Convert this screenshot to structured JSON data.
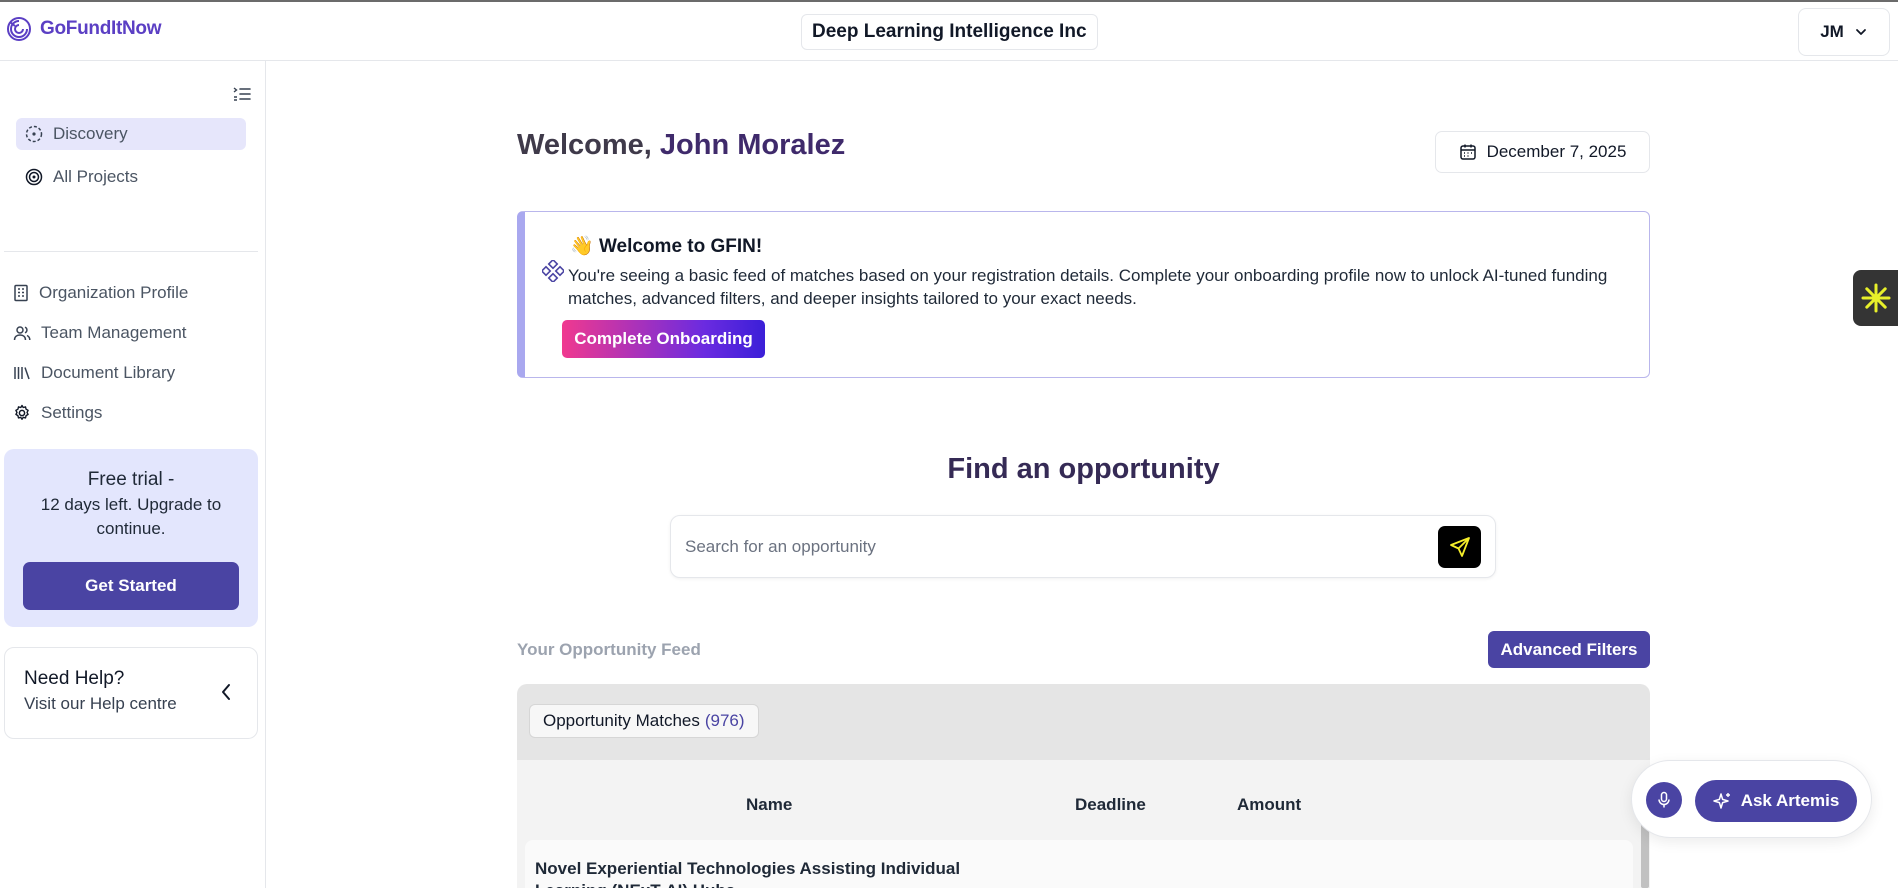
{
  "header": {
    "logo_text": "GoFundItNow",
    "organization": "Deep Learning Intelligence Inc",
    "user_initials": "JM"
  },
  "sidebar": {
    "primary": [
      {
        "label": "Discovery",
        "icon": "discovery-icon",
        "active": true
      },
      {
        "label": "All Projects",
        "icon": "target-icon",
        "active": false
      }
    ],
    "secondary": [
      {
        "label": "Organization Profile",
        "icon": "building-icon"
      },
      {
        "label": "Team Management",
        "icon": "users-icon"
      },
      {
        "label": "Document Library",
        "icon": "library-icon"
      },
      {
        "label": "Settings",
        "icon": "gear-icon"
      }
    ],
    "trial": {
      "title": "Free trial -",
      "subtitle": "12 days left. Upgrade to continue.",
      "button": "Get Started"
    },
    "help": {
      "title": "Need Help?",
      "subtitle": "Visit our Help centre"
    }
  },
  "main": {
    "welcome_prefix": "Welcome,",
    "welcome_name": "John Moralez",
    "date": "December 7, 2025",
    "banner": {
      "emoji": "👋",
      "title": "Welcome to GFIN!",
      "text": "You're seeing a basic feed of matches based on your registration details. Complete your onboarding profile now to unlock AI-tuned funding matches, advanced filters, and deeper insights tailored to your exact needs.",
      "button": "Complete Onboarding"
    },
    "find_title": "Find an opportunity",
    "search": {
      "placeholder": "Search for an opportunity",
      "value": ""
    },
    "feed_label": "Your Opportunity Feed",
    "advanced_filters": "Advanced Filters",
    "matches": {
      "label": "Opportunity Matches",
      "count": "(976)"
    },
    "table": {
      "columns": [
        "Name",
        "Deadline",
        "Amount"
      ],
      "rows": [
        {
          "name": "Novel Experiential Technologies Assisting Individual Learning (NExT-AI) Hubs"
        }
      ]
    }
  },
  "assistant": {
    "button": "Ask Artemis"
  },
  "colors": {
    "brand": "#5b3fc4",
    "primary_button": "#4a44a3",
    "active_nav": "#e6e6fb",
    "trial_card": "#e3e6fd"
  }
}
